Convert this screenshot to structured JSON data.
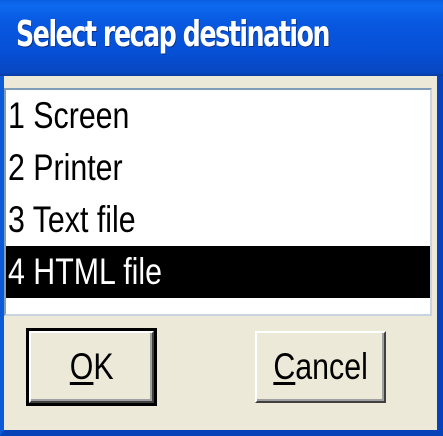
{
  "dialog": {
    "title": "Select recap destination"
  },
  "list": {
    "items": [
      {
        "label": "1 Screen",
        "selected": false
      },
      {
        "label": "2 Printer",
        "selected": false
      },
      {
        "label": "3 Text file",
        "selected": false
      },
      {
        "label": "4 HTML file",
        "selected": true
      }
    ],
    "selected_index": 3
  },
  "buttons": {
    "ok": {
      "mnemonic": "O",
      "rest": "K"
    },
    "cancel": {
      "mnemonic": "C",
      "rest": "ancel"
    }
  },
  "colors": {
    "titlebar": "#0650d6",
    "dialog_bg": "#ece9d8",
    "selection_bg": "#000000",
    "selection_fg": "#ffffff"
  }
}
